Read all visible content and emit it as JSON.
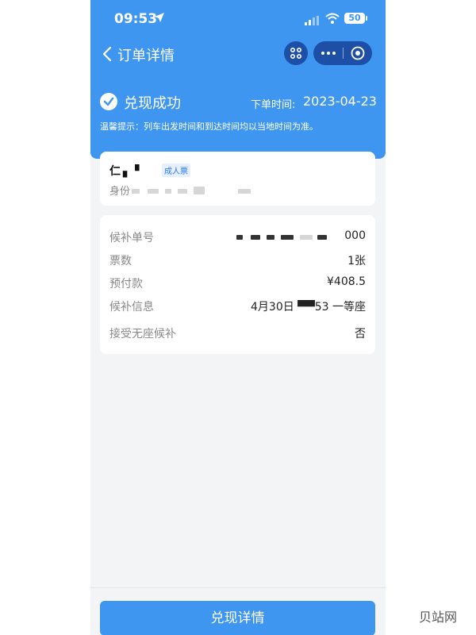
{
  "status_bar": {
    "time": "09:53",
    "battery": "50"
  },
  "nav": {
    "title": "订单详情"
  },
  "summary": {
    "status": "兑现成功",
    "order_time_label": "下单时间:",
    "order_time_value": "2023-04-23",
    "tip": "温馨提示：列车出发时间和到达时间均以当地时间为准。"
  },
  "passenger": {
    "name": "仁 ▖▝",
    "ticket_type": "成人票",
    "id_label": "身份"
  },
  "details": {
    "rows": [
      {
        "label": "候补单号",
        "value": "000"
      },
      {
        "label": "票数",
        "value": "1张"
      },
      {
        "label": "预付款",
        "value": "¥408.5"
      },
      {
        "label": "候补信息",
        "value": "4月30日 ▀▀53 一等座"
      },
      {
        "label": "接受无座候补",
        "value": "否"
      }
    ]
  },
  "bottom": {
    "button_label": "兑现详情"
  },
  "watermark": "贝站网",
  "colors": {
    "primary": "#3f96f0",
    "capsule": "#1d4fa7"
  },
  "icons": [
    "location-arrow-icon",
    "signal-icon",
    "wifi-icon",
    "back-chevron-icon",
    "scan-icon",
    "more-icon",
    "close-circle-icon",
    "check-circle-icon"
  ]
}
